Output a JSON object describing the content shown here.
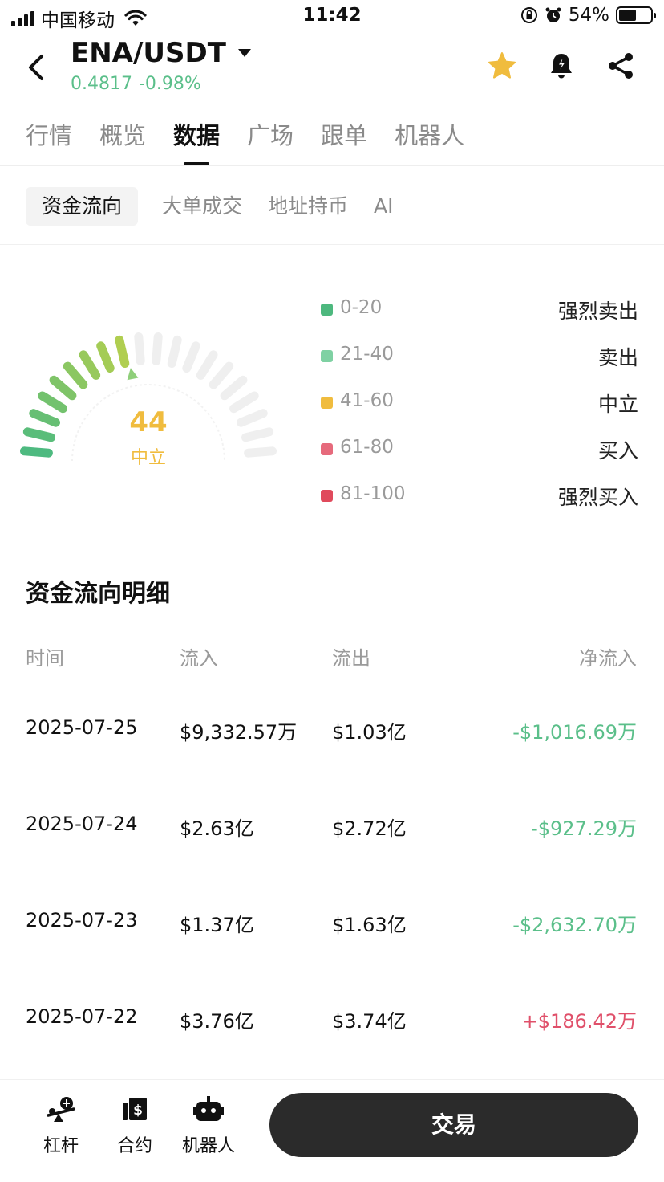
{
  "status_bar": {
    "carrier": "中国移动",
    "time": "11:42",
    "battery": "54%",
    "battery_level": 0.54
  },
  "header": {
    "pair": "ENA/USDT",
    "price": "0.4817",
    "change": "-0.98%",
    "icons": [
      "back-arrow-icon",
      "dropdown-caret-icon",
      "star-icon",
      "bell-alert-icon",
      "share-icon"
    ],
    "star_color": "#f0bc3e"
  },
  "main_tabs": [
    {
      "label": "行情",
      "active": false
    },
    {
      "label": "概览",
      "active": false
    },
    {
      "label": "数据",
      "active": true
    },
    {
      "label": "广场",
      "active": false
    },
    {
      "label": "跟单",
      "active": false
    },
    {
      "label": "机器人",
      "active": false
    }
  ],
  "sub_tabs": [
    {
      "label": "资金流向",
      "active": true
    },
    {
      "label": "大单成交",
      "active": false
    },
    {
      "label": "地址持币",
      "active": false
    },
    {
      "label": "AI",
      "active": false
    }
  ],
  "gauge": {
    "value": "44",
    "label": "中立",
    "min": 0,
    "max": 100,
    "value_color": "#f0bc3e"
  },
  "legend": [
    {
      "range": "0-20",
      "label": "强烈卖出",
      "color": "#4db87e"
    },
    {
      "range": "21-40",
      "label": "卖出",
      "color": "#7fd1a3"
    },
    {
      "range": "41-60",
      "label": "中立",
      "color": "#f0bc3e"
    },
    {
      "range": "61-80",
      "label": "买入",
      "color": "#e66a7c"
    },
    {
      "range": "81-100",
      "label": "强烈买入",
      "color": "#e04a5c"
    }
  ],
  "flow_detail": {
    "title": "资金流向明细",
    "columns": [
      "时间",
      "流入",
      "流出",
      "净流入"
    ],
    "rows": [
      {
        "date": "2025-07-25",
        "inflow": "$9,332.57万",
        "outflow": "$1.03亿",
        "net": "-$1,016.69万",
        "sign": "neg"
      },
      {
        "date": "2025-07-24",
        "inflow": "$2.63亿",
        "outflow": "$2.72亿",
        "net": "-$927.29万",
        "sign": "neg"
      },
      {
        "date": "2025-07-23",
        "inflow": "$1.37亿",
        "outflow": "$1.63亿",
        "net": "-$2,632.70万",
        "sign": "neg"
      },
      {
        "date": "2025-07-22",
        "inflow": "$3.76亿",
        "outflow": "$3.74亿",
        "net": "+$186.42万",
        "sign": "pos"
      }
    ],
    "negative_color": "#5bbf8a",
    "positive_color": "#e0506a"
  },
  "bottom_bar": {
    "items": [
      {
        "label": "杠杆",
        "icon": "leverage-icon"
      },
      {
        "label": "合约",
        "icon": "contract-icon"
      },
      {
        "label": "机器人",
        "icon": "robot-icon"
      }
    ],
    "trade_label": "交易"
  }
}
